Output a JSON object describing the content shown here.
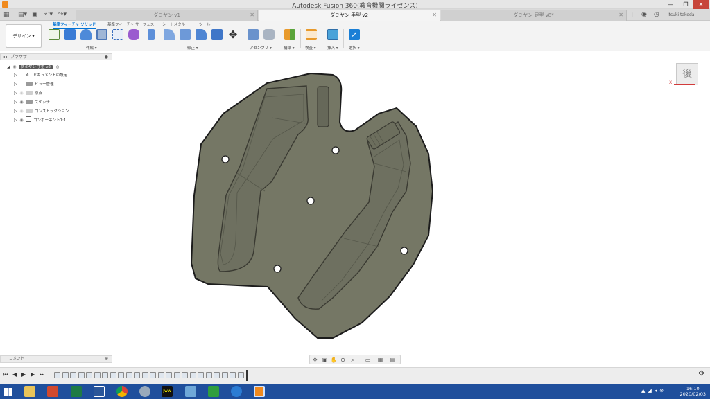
{
  "window": {
    "title": "Autodesk Fusion 360(教育機関ライセンス)"
  },
  "tabs": [
    {
      "label": "ダミヤン v1"
    },
    {
      "label": "ダミヤン 手型 v2"
    },
    {
      "label": "ダミヤン 足型 v8*"
    }
  ],
  "user": {
    "name": "itsuki takeda"
  },
  "toolbar": {
    "design_label": "デザイン ▾",
    "subtabs": [
      "基準フィーチャ ソリッド",
      "基準フィーチャ サーフェス",
      "シートメタル",
      "ツール"
    ],
    "groups": [
      "作成 ▾",
      "修正 ▾",
      "アセンブリ ▾",
      "構築 ▾",
      "検査 ▾",
      "挿入 ▾",
      "選択 ▾"
    ]
  },
  "browser": {
    "header": "ブラウザ",
    "root": "ダミヤン 手型 v2",
    "items": [
      "ドキュメントの設定",
      "ビュー管理",
      "原点",
      "スケッチ",
      "コンストラクション",
      "コンポーネント1:1"
    ]
  },
  "viewcube": {
    "face": "後",
    "axis_x": "X"
  },
  "comment": {
    "label": "コメント"
  },
  "taskbar": {
    "time": "16:10",
    "date": "2020/02/03",
    "apps": [
      "file-explorer",
      "powerpoint",
      "excel",
      "word",
      "chrome",
      "settings",
      "jw-cad",
      "notebook",
      "store",
      "edge",
      "fusion-360"
    ]
  }
}
